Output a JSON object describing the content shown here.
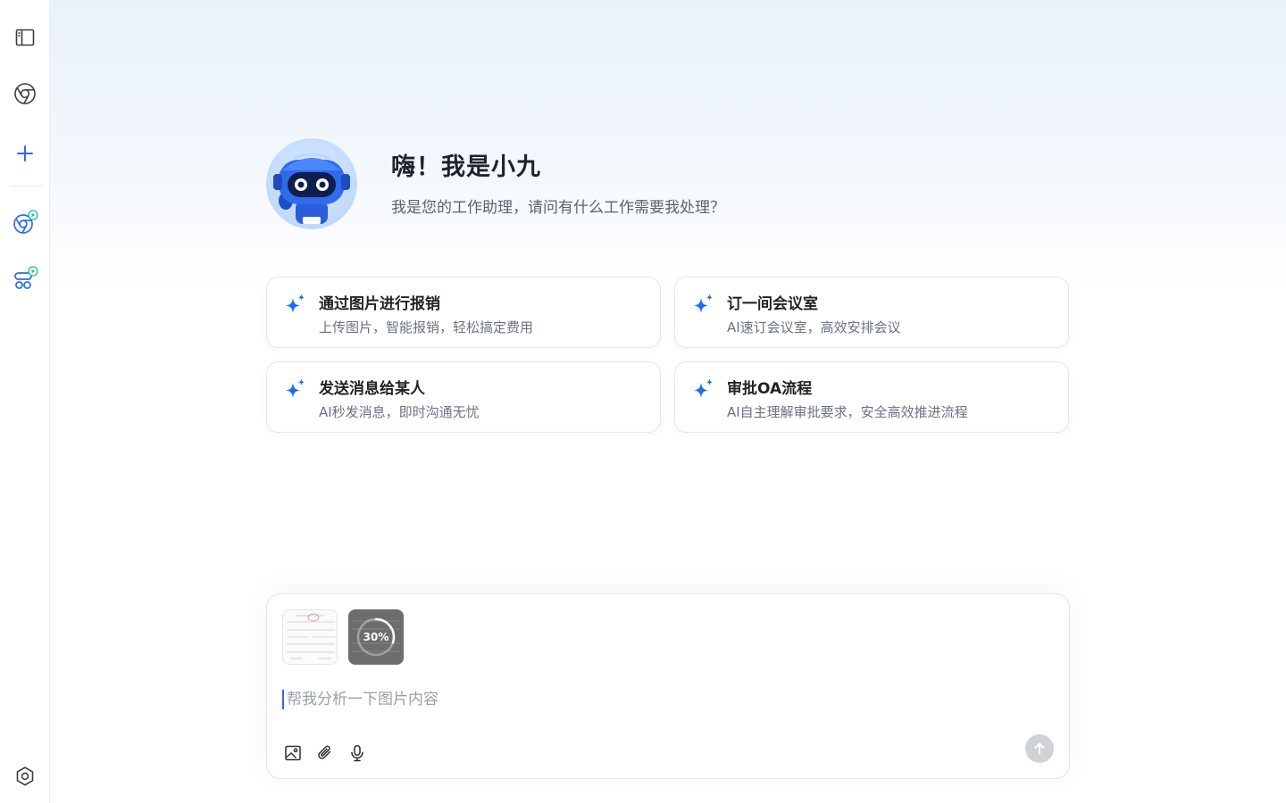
{
  "sidebar": {
    "items": [
      {
        "icon": "sidebar-panel-icon"
      },
      {
        "icon": "chrome-icon"
      },
      {
        "icon": "plus-icon"
      },
      {
        "icon": "chrome-play-icon"
      },
      {
        "icon": "robot-agent-icon"
      },
      {
        "icon": "settings-hexagon-icon"
      }
    ]
  },
  "welcome": {
    "title": "嗨！我是小九",
    "subtitle": "我是您的工作助理，请问有什么工作需要我处理？",
    "avatar_icon": "robot-avatar"
  },
  "suggestions": [
    {
      "title": "通过图片进行报销",
      "desc": "上传图片，智能报销，轻松搞定费用",
      "icon": "sparkle-icon"
    },
    {
      "title": "订一间会议室",
      "desc": "AI速订会议室，高效安排会议",
      "icon": "sparkle-icon"
    },
    {
      "title": "发送消息给某人",
      "desc": "AI秒发消息，即时沟通无忧",
      "icon": "sparkle-icon"
    },
    {
      "title": "审批OA流程",
      "desc": "AI自主理解审批要求，安全高效推进流程",
      "icon": "sparkle-icon"
    }
  ],
  "composer": {
    "attachments": [
      {
        "type": "image",
        "uploaded": true
      },
      {
        "type": "image",
        "progress_label": "30%",
        "progress": 0.3
      }
    ],
    "placeholder": "帮我分析一下图片内容",
    "value": "",
    "tools": [
      "image-icon",
      "paperclip-icon",
      "microphone-icon"
    ],
    "send_icon": "arrow-up-icon"
  },
  "colors": {
    "accent": "#2f6bea",
    "sparkle": "#1d6ff2",
    "send_disabled": "#cfd2d6"
  }
}
